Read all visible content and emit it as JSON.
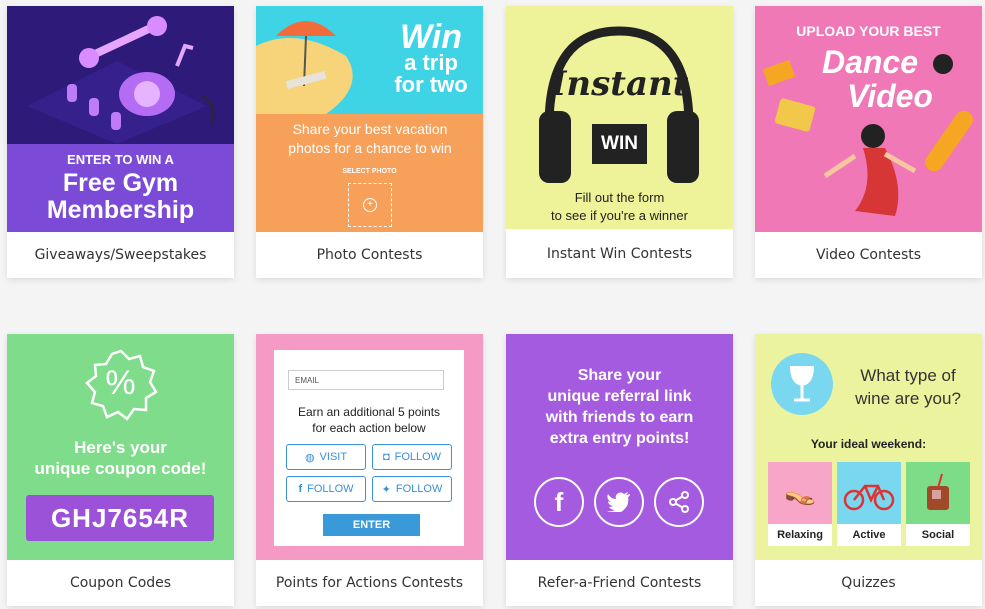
{
  "cards": [
    {
      "caption": "Giveaways/Sweepstakes",
      "line1": "ENTER TO WIN A",
      "line2": "Free Gym",
      "line3": "Membership"
    },
    {
      "caption": "Photo Contests",
      "headline_1": "Win",
      "headline_2": "a trip",
      "headline_3": "for two",
      "body": "Share your best vacation photos for a chance to win",
      "select_label": "SELECT PHOTO"
    },
    {
      "caption": "Instant Win Contests",
      "title": "Instant",
      "badge": "WIN",
      "body_1": "Fill out the form",
      "body_2": "to see if you're a winner"
    },
    {
      "caption": "Video Contests",
      "top_label": "UPLOAD YOUR BEST",
      "title_1": "Dance",
      "title_2": "Video"
    },
    {
      "caption": "Coupon Codes",
      "symbol": "%",
      "heading_1": "Here's your",
      "heading_2": "unique coupon code!",
      "code": "GHJ7654R"
    },
    {
      "caption": "Points for Actions Contests",
      "email_placeholder": "EMAIL",
      "body_1": "Earn an additional 5 points",
      "body_2": "for each action below",
      "actions": [
        "VISIT",
        "FOLLOW",
        "FOLLOW",
        "FOLLOW"
      ],
      "enter_label": "ENTER"
    },
    {
      "caption": "Refer-a-Friend Contests",
      "line1": "Share your",
      "line2": "unique referral link",
      "line3": "with friends to earn",
      "line4": "extra entry points!"
    },
    {
      "caption": "Quizzes",
      "question_1": "What type of",
      "question_2": "wine are you?",
      "subheading": "Your ideal weekend:",
      "options": [
        "Relaxing",
        "Active",
        "Social"
      ]
    }
  ],
  "colors": {
    "gym": "#7b4bd8",
    "photo": "#f6a05a",
    "instant": "#eef39a",
    "video": "#f078b6",
    "coupon": "#7fdc8a",
    "points": "#f49ac4",
    "refer": "#a55be0",
    "quiz": "#ecf39e",
    "link_blue": "#3a8fd8"
  }
}
